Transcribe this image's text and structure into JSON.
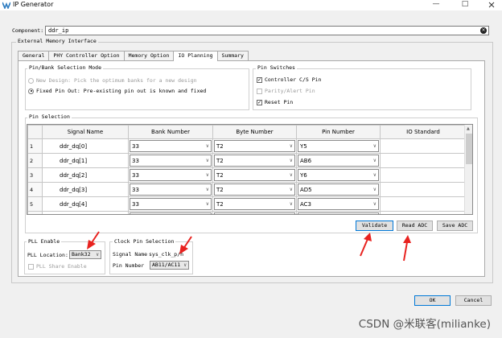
{
  "window": {
    "title": "IP Generator",
    "min": "—",
    "max": "□"
  },
  "component": {
    "label": "Component:",
    "value": "ddr_ip"
  },
  "emi_title": "External Memory Interface",
  "tabs": [
    "General",
    "PHY Controller Option",
    "Memory Option",
    "IO Planning",
    "Summary"
  ],
  "active_tab": "IO Planning",
  "pin_mode": {
    "title": "Pin/Bank Selection Mode",
    "new_design": "New Design: Pick the optimum banks for a new design",
    "fixed_pin": "Fixed Pin Out: Pre-existing pin out is known and fixed"
  },
  "pin_switches": {
    "title": "Pin Switches",
    "controller": "Controller C/S Pin",
    "parity": "Parity/Alert Pin",
    "reset": "Reset Pin"
  },
  "pin_selection": {
    "title": "Pin Selection",
    "columns": [
      "Signal Name",
      "Bank Number",
      "Byte Number",
      "Pin Number",
      "IO Standard"
    ],
    "rows": [
      {
        "num": "1",
        "signal": "ddr_dq[0]",
        "bank": "33",
        "byte": "T2",
        "pin": "Y5"
      },
      {
        "num": "2",
        "signal": "ddr_dq[1]",
        "bank": "33",
        "byte": "T2",
        "pin": "AB6"
      },
      {
        "num": "3",
        "signal": "ddr_dq[2]",
        "bank": "33",
        "byte": "T2",
        "pin": "Y6"
      },
      {
        "num": "4",
        "signal": "ddr_dq[3]",
        "bank": "33",
        "byte": "T2",
        "pin": "AD5"
      },
      {
        "num": "5",
        "signal": "ddr_dq[4]",
        "bank": "33",
        "byte": "T2",
        "pin": "AC3"
      }
    ]
  },
  "buttons": {
    "validate": "Validate",
    "read_adc": "Read ADC",
    "save_adc": "Save ADC",
    "ok": "OK",
    "cancel": "Cancel"
  },
  "pll": {
    "title": "PLL Enable",
    "location_label": "PLL Location:",
    "location_value": "Bank32",
    "share_label": "PLL Share Enable"
  },
  "clock": {
    "title": "Clock Pin Selection",
    "signal_label": "Signal Name",
    "signal_value": "sys_clk_p/n",
    "pin_label": "Pin Number",
    "pin_value": "AB11/AC11"
  },
  "watermark": "CSDN @米联客(milianke)",
  "colors": {
    "annotation_arrow": "#e8221f",
    "focus_border": "#0078d7"
  }
}
